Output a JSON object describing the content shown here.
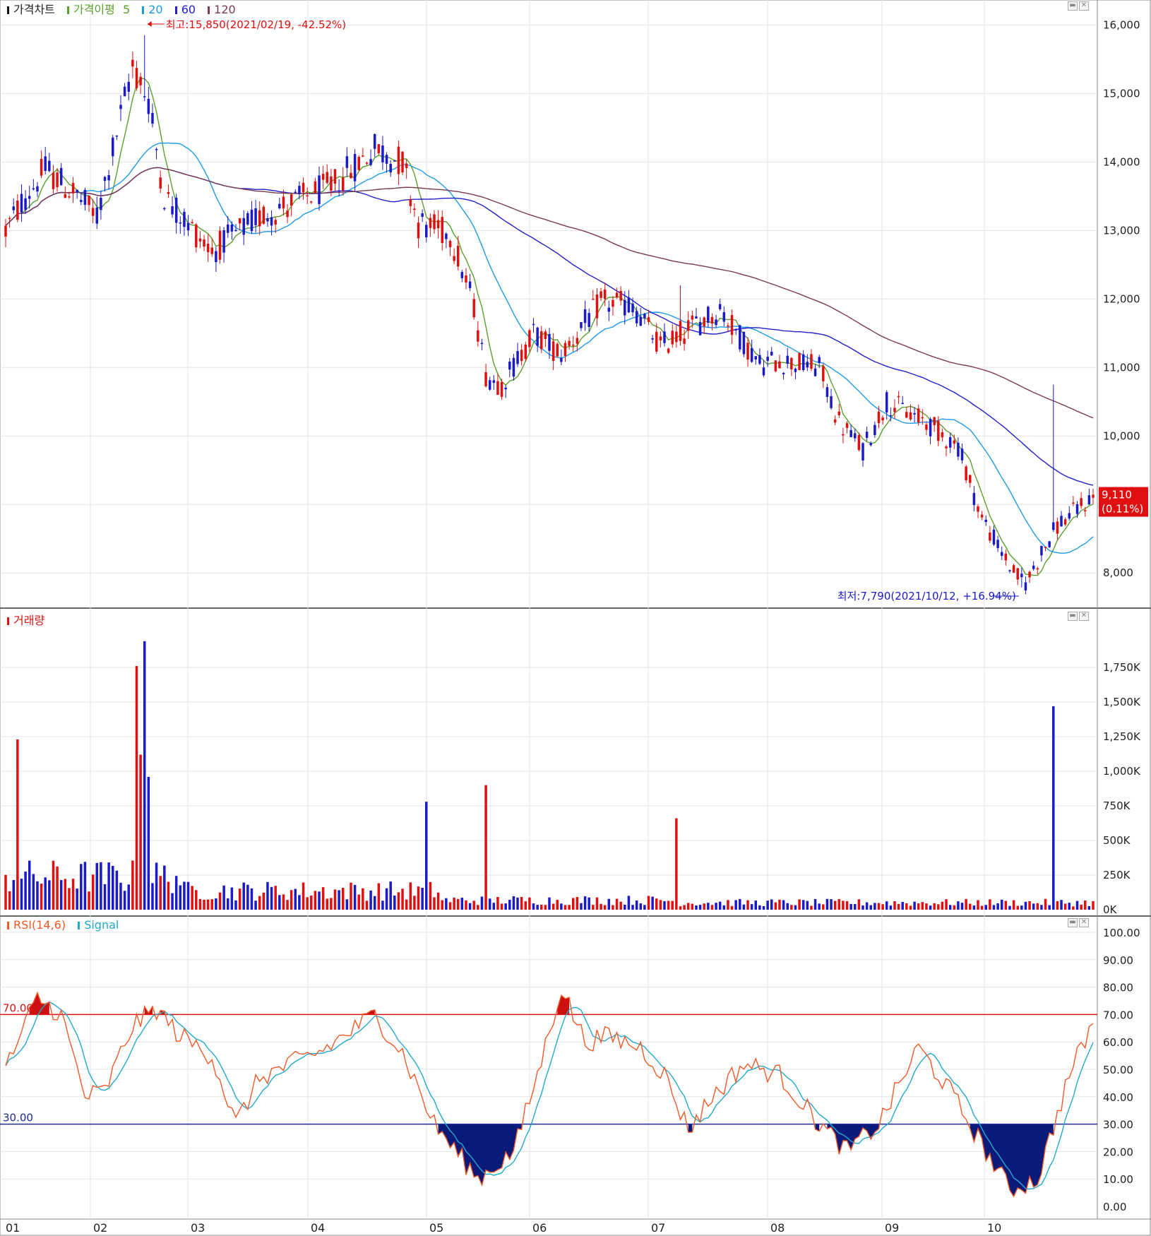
{
  "price_pane": {
    "title": "가격차트",
    "ma_label": "가격이평",
    "ma_periods": [
      "5",
      "20",
      "60",
      "120"
    ],
    "ma_colors": [
      "#5aa02c",
      "#1e9be6",
      "#2020c8",
      "#7a3b4e"
    ],
    "high_annotation": "최고:15,850(2021/02/19, -42.52%)",
    "low_annotation": "최저:7,790(2021/10/12, +16.94%)",
    "last_price": "9,110",
    "last_change": "(0.11%)",
    "yaxis_ticks": [
      "16,000",
      "15,000",
      "14,000",
      "13,000",
      "12,000",
      "11,000",
      "10,000",
      "8,000"
    ]
  },
  "volume_pane": {
    "title": "거래량",
    "yaxis_ticks": [
      "1,750K",
      "1,500K",
      "1,250K",
      "1,000K",
      "750K",
      "500K",
      "250K",
      "0K"
    ]
  },
  "rsi_pane": {
    "title": "RSI(14,6)",
    "signal_label": "Signal",
    "overbought": "70.00",
    "oversold": "30.00",
    "yaxis_ticks": [
      "100.00",
      "90.00",
      "80.00",
      "70.00",
      "60.00",
      "50.00",
      "40.00",
      "30.00",
      "20.00",
      "10.00",
      "0.00"
    ]
  },
  "xaxis_months": [
    "01",
    "02",
    "03",
    "04",
    "05",
    "06",
    "07",
    "08",
    "09",
    "10"
  ],
  "window_buttons": [
    "▬",
    "✕"
  ],
  "colors": {
    "up": "#e01010",
    "down": "#1a1ac8",
    "overbought_line": "#e01010",
    "oversold_line": "#1a2a9a"
  },
  "chart_data": {
    "type": "candlestick",
    "ylim": [
      7600,
      16200
    ],
    "volume_ylim": [
      0,
      2000
    ],
    "rsi_ylim": [
      0,
      100
    ],
    "price_keypoints": [
      [
        0,
        13000
      ],
      [
        4,
        13400
      ],
      [
        10,
        13900
      ],
      [
        18,
        13500
      ],
      [
        23,
        13200
      ],
      [
        32,
        15400
      ],
      [
        36,
        14900
      ],
      [
        40,
        13500
      ],
      [
        52,
        12700
      ],
      [
        64,
        13200
      ],
      [
        82,
        13650
      ],
      [
        93,
        14200
      ],
      [
        100,
        14000
      ],
      [
        104,
        13100
      ],
      [
        112,
        12950
      ],
      [
        118,
        11900
      ],
      [
        121,
        10900
      ],
      [
        125,
        10750
      ],
      [
        133,
        11500
      ],
      [
        140,
        11200
      ],
      [
        150,
        11950
      ],
      [
        158,
        11900
      ],
      [
        165,
        11300
      ],
      [
        170,
        11500
      ],
      [
        180,
        11850
      ],
      [
        190,
        11050
      ],
      [
        195,
        11100
      ],
      [
        205,
        11000
      ],
      [
        210,
        10200
      ],
      [
        216,
        9800
      ],
      [
        222,
        10500
      ],
      [
        232,
        10200
      ],
      [
        240,
        9850
      ],
      [
        246,
        8800
      ],
      [
        254,
        8000
      ],
      [
        257,
        7850
      ],
      [
        262,
        8400
      ],
      [
        265,
        8700
      ],
      [
        274,
        9110
      ]
    ],
    "volume_spikes": [
      [
        3,
        1230
      ],
      [
        33,
        1760
      ],
      [
        35,
        1940
      ],
      [
        34,
        1120
      ],
      [
        36,
        960
      ],
      [
        106,
        780
      ],
      [
        121,
        900
      ],
      [
        169,
        660
      ],
      [
        264,
        1470
      ]
    ],
    "rsi_keypoints": [
      [
        0,
        50
      ],
      [
        8,
        76
      ],
      [
        14,
        70
      ],
      [
        20,
        40
      ],
      [
        25,
        42
      ],
      [
        32,
        66
      ],
      [
        38,
        72
      ],
      [
        44,
        62
      ],
      [
        52,
        55
      ],
      [
        58,
        30
      ],
      [
        64,
        47
      ],
      [
        80,
        57
      ],
      [
        93,
        70
      ],
      [
        100,
        56
      ],
      [
        108,
        30
      ],
      [
        119,
        10
      ],
      [
        128,
        20
      ],
      [
        134,
        48
      ],
      [
        140,
        80
      ],
      [
        146,
        60
      ],
      [
        152,
        62
      ],
      [
        160,
        58
      ],
      [
        166,
        48
      ],
      [
        172,
        28
      ],
      [
        178,
        40
      ],
      [
        186,
        52
      ],
      [
        195,
        48
      ],
      [
        205,
        30
      ],
      [
        212,
        20
      ],
      [
        220,
        30
      ],
      [
        230,
        58
      ],
      [
        238,
        42
      ],
      [
        247,
        20
      ],
      [
        253,
        6
      ],
      [
        260,
        10
      ],
      [
        268,
        48
      ],
      [
        274,
        67
      ]
    ],
    "ma_periods": [
      5,
      20,
      60,
      120
    ],
    "bars": 275
  }
}
